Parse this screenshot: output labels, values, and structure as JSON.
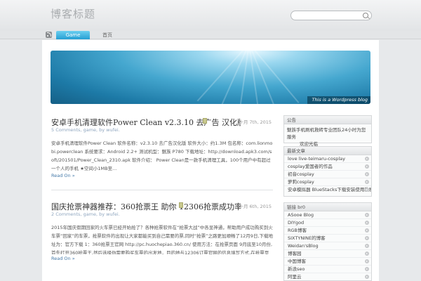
{
  "header": {
    "site_title": "博客标题",
    "search_placeholder": ""
  },
  "nav": {
    "tabs": [
      {
        "label": "Game"
      },
      {
        "label": "首页"
      }
    ]
  },
  "banner": {
    "caption": "This is a Wordpress blog"
  },
  "posts": [
    {
      "title": "安卓手机清理软件Power Clean v2.3.10 去广告 汉化版",
      "date": "十月 7th, 2015",
      "meta": "5 Comments, game, by wufei.",
      "excerpt": "安卓手机清理软件Power Clean 软件名称：v2.3.10 去广告汉化版 软件大小：约1.3M 包名称：com.lionmobi.powerclean 系统要求：Android 2.2+ 测试机型：魅族 P780 下载地址：http://download.apk3.com/soft/201501/Power_Clean_2310.apk 软件介绍： Power Clean是一款手机清理工具，100个用户中有超过一个人的手机 ★空间小1MB至...",
      "read_on": "Read On »"
    },
    {
      "title": "国庆抢票神器推荐：360抢票王 助你 12306抢票成功率",
      "date": "十月 6th, 2015",
      "meta": "2 Comments, game, by wufei.",
      "excerpt": "2015年国庆假期回家的火车票已经开始抢了？各种抢票软件在“抢票大战”中各显神通，帮助用户成功购买到火车票“回家”的车票，抢票软件的出现让大家都能买到自己需要的票,同时“抢票”之路更加顺畅了12月9日,下载地址为：官方下载 1：360抢票王官网 http://pc.huochepiao.360.cn/ 使用方法：在抢票页面 9月底至10月份,首先打开360抢票王,然后选择你需要购买车票的出发地，目的地与12306订票官网的信息填写方式,在抢票页面选择你的车次,然后点击“抢”按钮,然后就可以实时抢票了你的 “抢”票成功...",
      "read_on": "Read On »"
    }
  ],
  "sidebar": {
    "widgets": [
      {
        "title": "公告",
        "text": "魅族手机刷机救砖专业团队24小时为您服务",
        "text2": "欢迎光临"
      },
      {
        "title": "最新文章",
        "items": [
          "love live-teimaru-cosplay",
          "cosplay爱国者的作品",
          "初音cosplay",
          "萝莉cosplay",
          "安卓模拟器 BlueStacks下载安装使用教程"
        ]
      },
      {
        "title": "链接 br0",
        "items": [
          "ASooe Blog",
          "DIYgod",
          "RGB博客",
          "SIXTYNINE的博客",
          "Weidan'sBlog",
          "博客园",
          "中国博客",
          "新浪seo",
          "阿里云"
        ]
      }
    ]
  }
}
